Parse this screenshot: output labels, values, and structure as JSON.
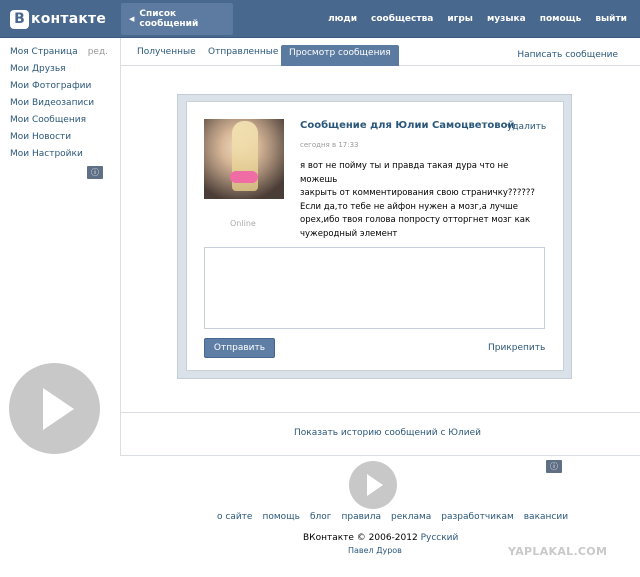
{
  "header": {
    "logo_letter": "B",
    "logo_text": "контакте",
    "back_label": "Список сообщений",
    "nav": [
      "люди",
      "сообщества",
      "игры",
      "музыка",
      "помощь",
      "выйти"
    ]
  },
  "left_menu": {
    "items": [
      "Моя Страница",
      "Мои Друзья",
      "Мои Фотографии",
      "Мои Видеозаписи",
      "Мои Сообщения",
      "Мои Новости",
      "Мои Настройки"
    ],
    "edit_label": "ред."
  },
  "tabs": {
    "items": [
      "Полученные",
      "Отправленные",
      "Просмотр сообщения"
    ],
    "write_label": "Написать сообщение"
  },
  "message": {
    "title": "Сообщение для Юлии Самоцветовой",
    "delete_label": "удалить",
    "time": "сегодня в 17:33",
    "body_lines": [
      "я вот не пойму ты и правда такая дура что не можешь",
      "закрыть от комментирования свою страничку??????",
      "Если да,то тебе не айфон нужен а мозг,а лучше",
      "орех,ибо твоя голова попросту отторгнет мозг как",
      "чужеродный элемент"
    ],
    "status": "Online",
    "send_label": "Отправить",
    "attach_label": "Прикрепить",
    "history_label": "Показать историю сообщений с Юлией"
  },
  "footer": {
    "links": [
      "о сайте",
      "помощь",
      "блог",
      "правила",
      "реклама",
      "разработчикам",
      "вакансии"
    ],
    "copyright": "ВКонтакте © 2006-2012",
    "language": "Русский",
    "author": "Павел Дуров"
  },
  "watermark": "YAPLAKAL.COM",
  "colors": {
    "header_bg": "#49688e",
    "link": "#2b587a",
    "active_tab": "#5c7ba0"
  }
}
